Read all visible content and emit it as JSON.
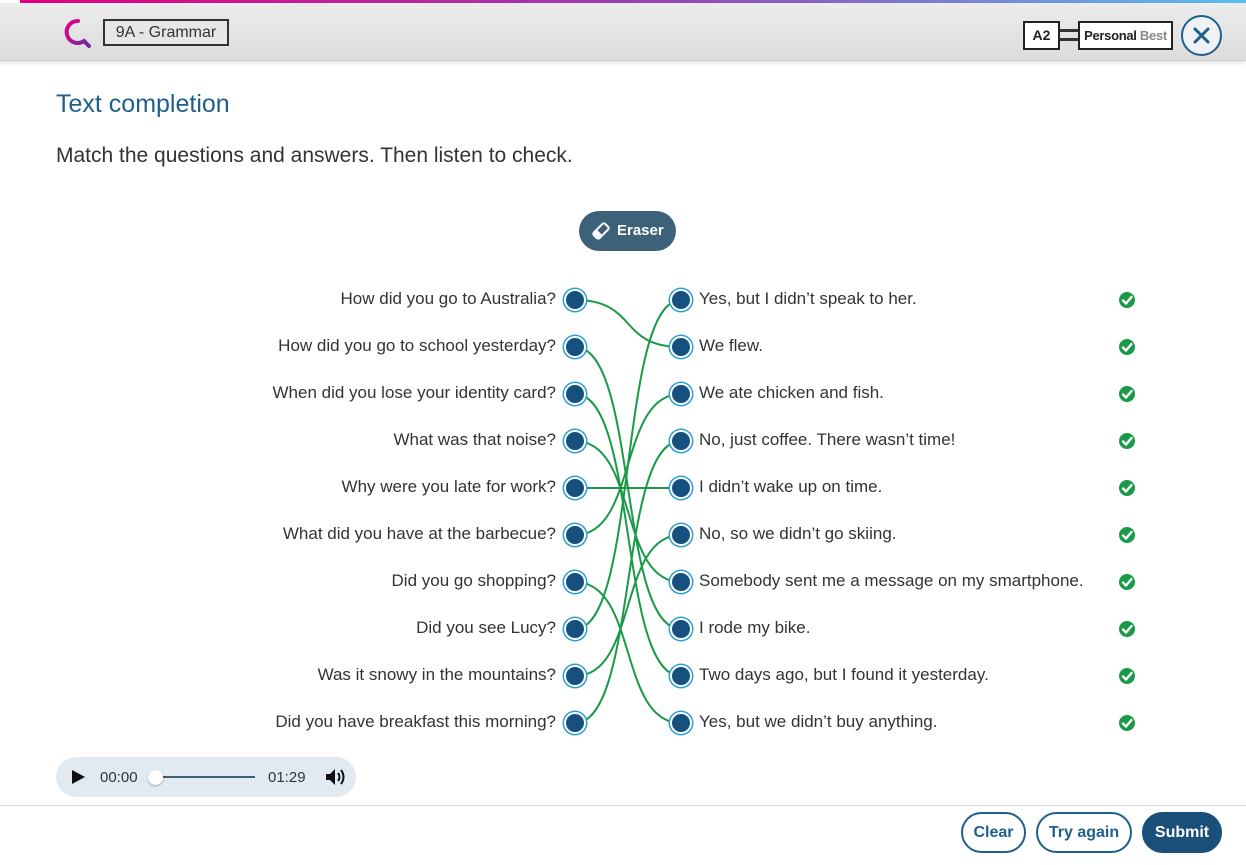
{
  "header": {
    "unit_label": "9A - Grammar",
    "level": "A2",
    "brand_main": "Personal",
    "brand_accent": "Best"
  },
  "activity": {
    "title": "Text completion",
    "instruction": "Match the questions and answers. Then listen to check.",
    "eraser_label": "Eraser"
  },
  "questions": [
    "How did you go to Australia?",
    "How did you go to school yesterday?",
    "When did you lose your identity card?",
    "What was that noise?",
    "Why were you late for work?",
    "What did you have at the barbecue?",
    "Did you go shopping?",
    "Did you see Lucy?",
    "Was it snowy in the mountains?",
    "Did you have breakfast this morning?"
  ],
  "answers": [
    "Yes, but I didn’t speak to her.",
    "We flew.",
    "We ate chicken and fish.",
    "No, just coffee. There wasn’t time!",
    "I didn’t wake up on time.",
    "No, so we didn’t go skiing.",
    "Somebody sent me a message on my smartphone.",
    "I rode my bike.",
    "Two days ago, but I found it yesterday.",
    "Yes, but we didn’t buy anything."
  ],
  "matches": [
    1,
    7,
    8,
    6,
    4,
    2,
    9,
    0,
    5,
    3
  ],
  "answer_status": [
    "correct",
    "correct",
    "correct",
    "correct",
    "correct",
    "correct",
    "correct",
    "correct",
    "correct",
    "correct"
  ],
  "audio": {
    "current_time": "00:00",
    "total_time": "01:29",
    "progress": 0
  },
  "footer": {
    "clear_label": "Clear",
    "try_again_label": "Try again",
    "submit_label": "Submit"
  },
  "colors": {
    "accent": "#1f5f8b",
    "dot": "#16507e",
    "line": "#1a9a48",
    "check": "#1a9a48",
    "eraser_bg": "#3d6178",
    "submit_bg": "#1a4f7a"
  },
  "icons": {
    "logo": "brand-logo-icon",
    "close": "close-icon",
    "eraser": "eraser-icon",
    "check": "check-circle-icon",
    "play": "play-icon",
    "volume": "volume-icon"
  }
}
